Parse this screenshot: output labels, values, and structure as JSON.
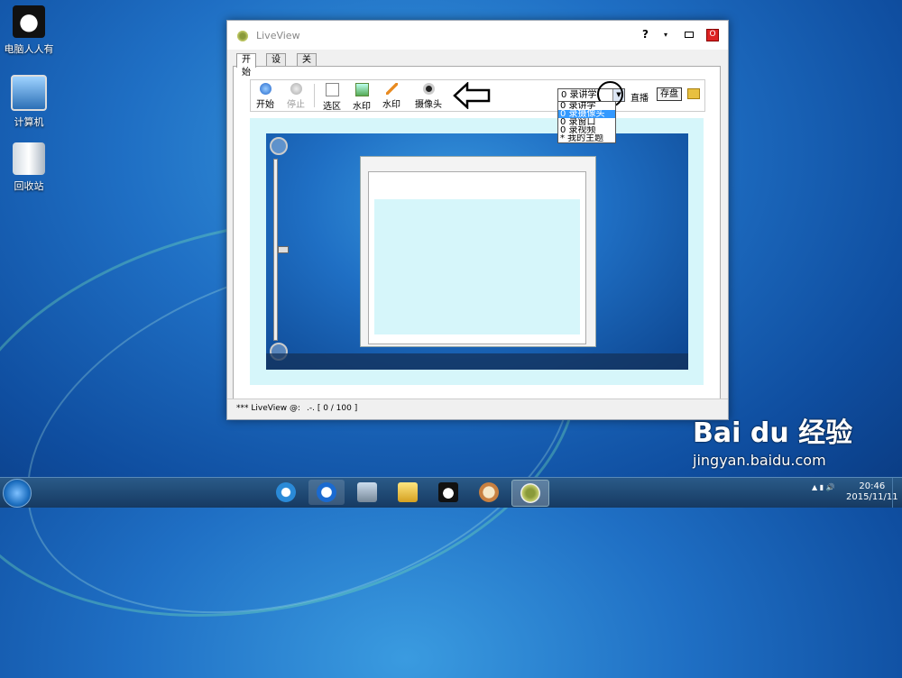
{
  "desktop": {
    "icons": [
      {
        "label": "电脑人人有",
        "icon": "panda-icon"
      },
      {
        "label": "计算机",
        "icon": "computer-icon"
      },
      {
        "label": "回收站",
        "icon": "recycle-bin-icon"
      }
    ]
  },
  "window": {
    "title": "LiveView",
    "help": "?",
    "tabs": [
      {
        "label": "开始",
        "active": true
      },
      {
        "label": "设置",
        "active": false
      },
      {
        "label": "关于",
        "active": false
      }
    ],
    "toolbar": {
      "start": "开始",
      "stop": "停止",
      "select_region": "选区",
      "watermark1": "水印",
      "watermark2": "水印",
      "camera": "摄像头",
      "dropdown_selected": "0 录讲学",
      "dropdown_options": [
        "0 录讲学",
        "0 录摄像头",
        "0 录窗口",
        "0 录视频",
        "* 我的主题"
      ],
      "broadcast": "直播",
      "save": "存盘"
    },
    "status": {
      "left": "*** LiveView @:",
      "right": ".-. [ 0 / 100 ]"
    }
  },
  "watermark": {
    "logo": "Bai du 经验",
    "url": "jingyan.baidu.com"
  },
  "taskbar": {
    "time": "20:46",
    "date": "2015/11/11"
  },
  "colors": {
    "preview_bg": "#d6f6fa",
    "close_red": "#dd2222",
    "dropdown_highlight": "#3399ff"
  }
}
